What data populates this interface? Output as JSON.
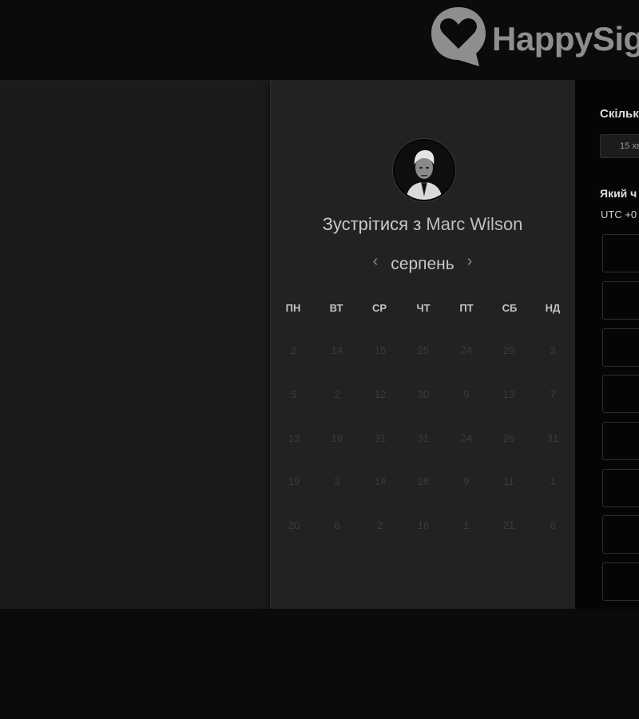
{
  "brand": {
    "logo_text": "HappySig"
  },
  "host": {
    "prefix": "Зустрітися з",
    "name": "Marc Wilson"
  },
  "calendar": {
    "month": "серпень",
    "weekdays": [
      "ПН",
      "ВТ",
      "СР",
      "ЧТ",
      "ПТ",
      "СБ",
      "НД"
    ],
    "weeks": [
      [
        "2",
        "14",
        "15",
        "25",
        "24",
        "29",
        "3"
      ],
      [
        "5",
        "2",
        "12",
        "30",
        "9",
        "13",
        "7"
      ],
      [
        "13",
        "19",
        "31",
        "31",
        "24",
        "26",
        "31"
      ],
      [
        "19",
        "3",
        "14",
        "28",
        "9",
        "11",
        "1"
      ],
      [
        "20",
        "6",
        "2",
        "16",
        "1",
        "21",
        "6"
      ]
    ]
  },
  "side": {
    "duration_label": "Скільк",
    "duration_value": "15 хв",
    "time_label": "Який ч",
    "timezone": "UTC +0"
  }
}
